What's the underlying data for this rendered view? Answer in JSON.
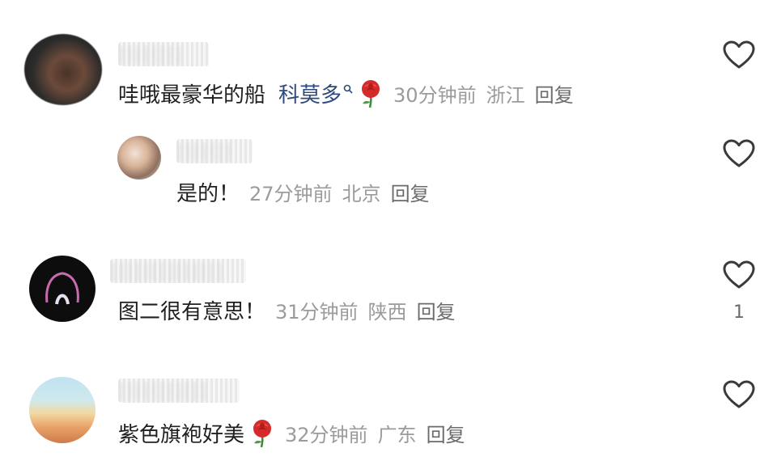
{
  "comments": [
    {
      "text": "哇哦最豪华的船",
      "mention": "科莫多",
      "emoji": "rose",
      "time": "30分钟前",
      "location": "浙江",
      "reply_label": "回复",
      "like_icon": "heart-outline-icon"
    },
    {
      "text": "是的！",
      "time": "27分钟前",
      "location": "北京",
      "reply_label": "回复",
      "like_icon": "heart-outline-icon"
    },
    {
      "text": "图二很有意思！",
      "time": "31分钟前",
      "location": "陕西",
      "reply_label": "回复",
      "like_icon": "heart-outline-icon",
      "like_count": "1"
    },
    {
      "text": "紫色旗袍好美",
      "emoji": "rose",
      "time": "32分钟前",
      "location": "广东",
      "reply_label": "回复",
      "like_icon": "heart-outline-icon"
    }
  ],
  "colors": {
    "text": "#1f1f1f",
    "meta": "#9b9b9b",
    "mention": "#2f4a7a",
    "icon": "#3a3a3a",
    "rose": "#d62a2a"
  }
}
